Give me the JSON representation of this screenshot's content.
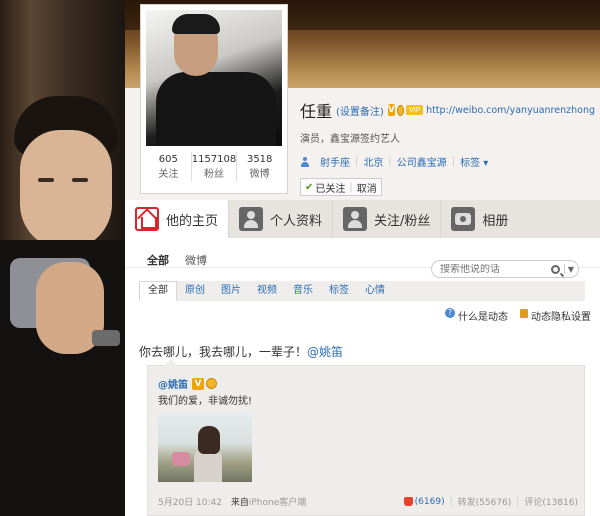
{
  "profile": {
    "name": "任重",
    "set_remark": "(设置备注)",
    "v_badge": "V",
    "vip_badge": "VIP",
    "home_url": "http://weibo.com/yanyuanrenzhong",
    "description": "演员，鑫宝源签约艺人",
    "tags": [
      "射手座",
      "北京",
      "公司鑫宝源"
    ],
    "tag_dropdown": "标签 ▾",
    "follow_status": "已关注",
    "cancel": "取消",
    "stats": [
      {
        "value": "605",
        "label": "关注"
      },
      {
        "value": "1157108",
        "label": "粉丝"
      },
      {
        "value": "3518",
        "label": "微博"
      }
    ]
  },
  "tabs": [
    {
      "label": "他的主页",
      "icon": "home-icon",
      "active": true
    },
    {
      "label": "个人资料",
      "icon": "person-icon"
    },
    {
      "label": "关注/粉丝",
      "icon": "people-icon"
    },
    {
      "label": "相册",
      "icon": "camera-icon"
    }
  ],
  "feed": {
    "tab_all": "全部",
    "tab_weibo": "微博",
    "search_placeholder": "搜索他说的话",
    "filters": [
      "全部",
      "原创",
      "图片",
      "视频",
      "音乐",
      "标签",
      "心情"
    ],
    "what_is_feed": "什么是动态",
    "privacy": "动态隐私设置"
  },
  "post": {
    "text": "你去哪儿，我去哪儿，一辈子！",
    "mention": "@姚笛",
    "repost": {
      "user": "@姚笛",
      "text": "我们的爱，非诚勿扰!",
      "time": "5月20日 10:42",
      "source_prefix": "来自",
      "source": "iPhone客户端",
      "likes": "(6169)",
      "forward": "转发(55676)",
      "comment": "评论(13816)"
    }
  }
}
